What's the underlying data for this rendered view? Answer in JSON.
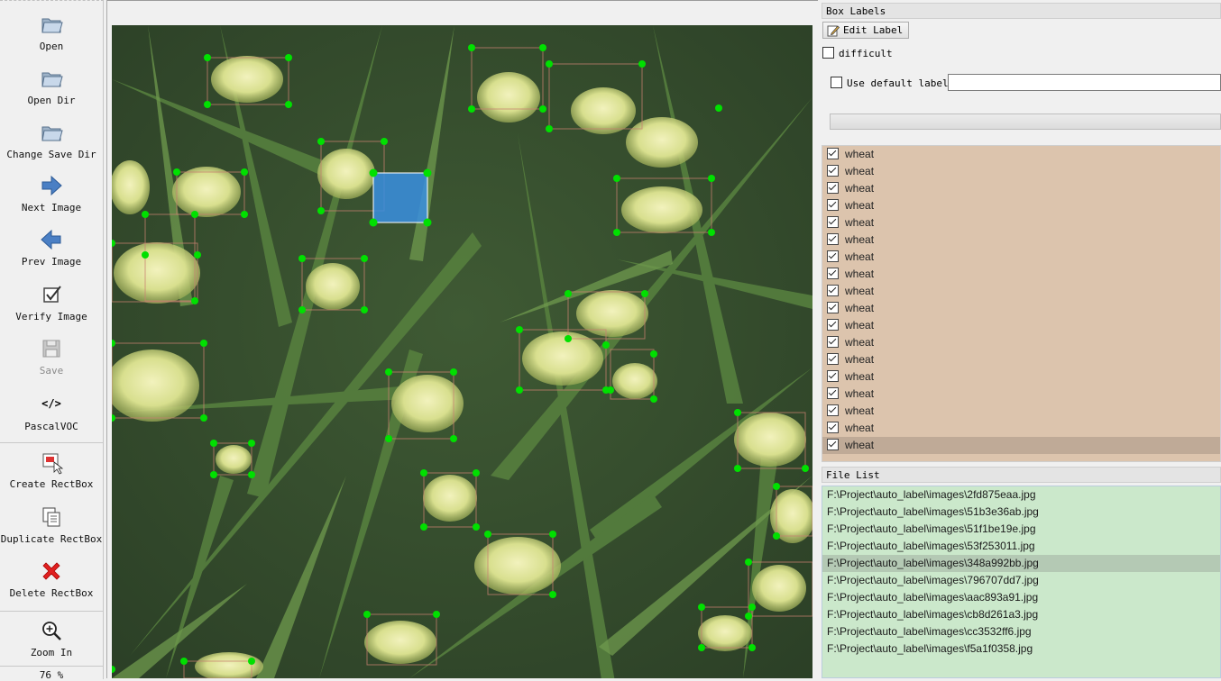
{
  "toolbar": {
    "open": "Open",
    "open_dir": "Open Dir",
    "change_save_dir": "Change Save Dir",
    "next_image": "Next Image",
    "prev_image": "Prev Image",
    "verify_image": "Verify Image",
    "save": "Save",
    "format_icon": "</>",
    "format": "PascalVOC",
    "create_rectbox": "Create RectBox",
    "duplicate_rectbox": "Duplicate RectBox",
    "delete_rectbox": "Delete RectBox",
    "zoom_in": "Zoom In",
    "zoom_level": "76 %"
  },
  "box_labels": {
    "title": "Box Labels",
    "edit_label_button": "Edit Label",
    "difficult_label": "difficult",
    "difficult_checked": false,
    "use_default_label": "Use default label",
    "use_default_checked": false,
    "default_label_value": "",
    "items": [
      "wheat",
      "wheat",
      "wheat",
      "wheat",
      "wheat",
      "wheat",
      "wheat",
      "wheat",
      "wheat",
      "wheat",
      "wheat",
      "wheat",
      "wheat",
      "wheat",
      "wheat",
      "wheat",
      "wheat",
      "wheat"
    ],
    "items_checked": true,
    "selected_index": 17
  },
  "file_list": {
    "title": "File List",
    "files": [
      "F:\\Project\\auto_label\\images\\2fd875eaa.jpg",
      "F:\\Project\\auto_label\\images\\51b3e36ab.jpg",
      "F:\\Project\\auto_label\\images\\51f1be19e.jpg",
      "F:\\Project\\auto_label\\images\\53f253011.jpg",
      "F:\\Project\\auto_label\\images\\348a992bb.jpg",
      "F:\\Project\\auto_label\\images\\796707dd7.jpg",
      "F:\\Project\\auto_label\\images\\aac893a91.jpg",
      "F:\\Project\\auto_label\\images\\cb8d261a3.jpg",
      "F:\\Project\\auto_label\\images\\cc3532ff6.jpg",
      "F:\\Project\\auto_label\\images\\f5a1f0358.jpg"
    ],
    "selected_index": 4
  },
  "colors": {
    "label_list_bg": "#dcc4ad",
    "file_list_bg": "#cbe8cb",
    "box_vertex": "#00e000",
    "selected_box_fill": "#3a8fe0"
  }
}
